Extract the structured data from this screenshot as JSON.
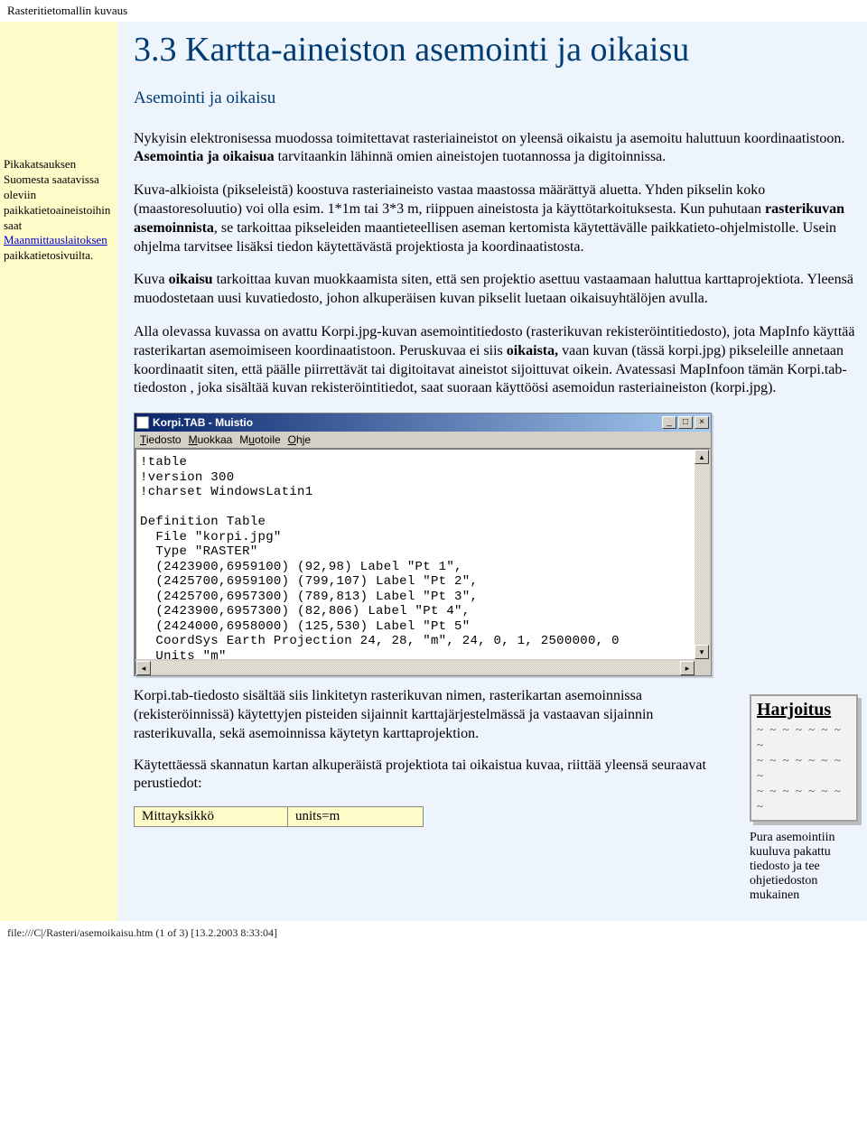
{
  "page_header": "Rasteritietomallin kuvaus",
  "title": "3.3 Kartta-aineiston asemointi ja oikaisu",
  "subtitle": "Asemointi ja oikaisu",
  "sidebar": {
    "intro": "Pikakatsauksen Suomesta saatavissa oleviin paikkatietoaineistoihin saat ",
    "link": "Maanmittauslaitoksen",
    "outro": " paikkatietosivuilta."
  },
  "paragraphs": {
    "p1a": "Nykyisin elektronisessa muodossa toimitettavat rasteriaineistot on yleensä oikaistu ja asemoitu haluttuun koordinaatistoon. ",
    "p1b": "Asemointia ja oikaisua",
    "p1c": "  tarvitaankin lähinnä omien aineistojen tuotannossa ja digitoinnissa.",
    "p2a": "Kuva-alkioista (pikseleistä) koostuva rasteriaineisto vastaa maastossa määrättyä aluetta.  Yhden pikselin koko (maastoresoluutio) voi olla esim. 1*1m tai 3*3 m, riippuen aineistosta ja käyttötarkoituksesta. Kun puhutaan ",
    "p2b": "rasterikuvan asemoinnista",
    "p2c": ", se tarkoittaa pikseleiden maantieteellisen aseman kertomista käytettävälle paikkatieto-ohjelmistolle. Usein ohjelma tarvitsee lisäksi tiedon käytettävästä projektiosta ja koordinaatistosta.",
    "p3a": "Kuva ",
    "p3b": "oikaisu",
    "p3c": " tarkoittaa kuvan muokkaamista siten, että sen projektio asettuu vastaamaan haluttua karttaprojektiota. Yleensä muodostetaan uusi kuvatiedosto, johon alkuperäisen kuvan pikselit luetaan oikaisuyhtälöjen avulla.",
    "p4a": "Alla olevassa kuvassa on avattu Korpi.jpg-kuvan asemointitiedosto (rasterikuvan rekisteröintitiedosto), jota MapInfo käyttää rasterikartan asemoimiseen koordinaatistoon. Peruskuvaa ei siis ",
    "p4b": "oikaista,",
    "p4c": " vaan kuvan (tässä korpi.jpg) pikseleille annetaan koordinaatit siten, että päälle piirrettävät tai digitoitavat aineistot sijoittuvat oikein.  Avatessasi MapInfoon tämän Korpi.tab-tiedoston , joka sisältää kuvan rekisteröintitiedot, saat suoraan käyttöösi asemoidun rasteriaineiston (korpi.jpg)."
  },
  "notepad": {
    "title": "Korpi.TAB - Muistio",
    "menu": {
      "file": "Tiedosto",
      "edit": "Muokkaa",
      "format": "Muotoile",
      "help": "Ohje"
    },
    "content_lines": [
      "!table",
      "!version 300",
      "!charset WindowsLatin1",
      "",
      "Definition Table",
      "  File \"korpi.jpg\"",
      "  Type \"RASTER\"",
      "  (2423900,6959100) (92,98) Label \"Pt 1\",",
      "  (2425700,6959100) (799,107) Label \"Pt 2\",",
      "  (2425700,6957300) (789,813) Label \"Pt 3\",",
      "  (2423900,6957300) (82,806) Label \"Pt 4\",",
      "  (2424000,6958000) (125,530) Label \"Pt 5\"",
      "  CoordSys Earth Projection 24, 28, \"m\", 24, 0, 1, 2500000, 0",
      "  Units \"m\""
    ]
  },
  "bottom": {
    "p5": "Korpi.tab-tiedosto sisältää siis linkitetyn rasterikuvan nimen, rasterikartan asemoinnissa (rekisteröinnissä) käytettyjen pisteiden sijainnit karttajärjestelmässä ja vastaavan sijainnin rasterikuvalla, sekä asemoinnissa käytetyn karttaprojektion.",
    "p6": "Käytettäessä skannatun kartan alkuperäistä projektiota tai oikaistua kuvaa, riittää yleensä seuraavat perustiedot:",
    "table": {
      "c1": "Mittayksikkö",
      "c2": "units=m"
    }
  },
  "harjoitus": {
    "title": "Harjoitus",
    "tildes": "~ ~ ~ ~ ~ ~ ~ ~",
    "text": "Pura asemointiin kuuluva pakattu tiedosto ja tee ohjetiedoston mukainen"
  },
  "footer": "file:///C|/Rasteri/asemoikaisu.htm (1 of 3) [13.2.2003 8:33:04]"
}
